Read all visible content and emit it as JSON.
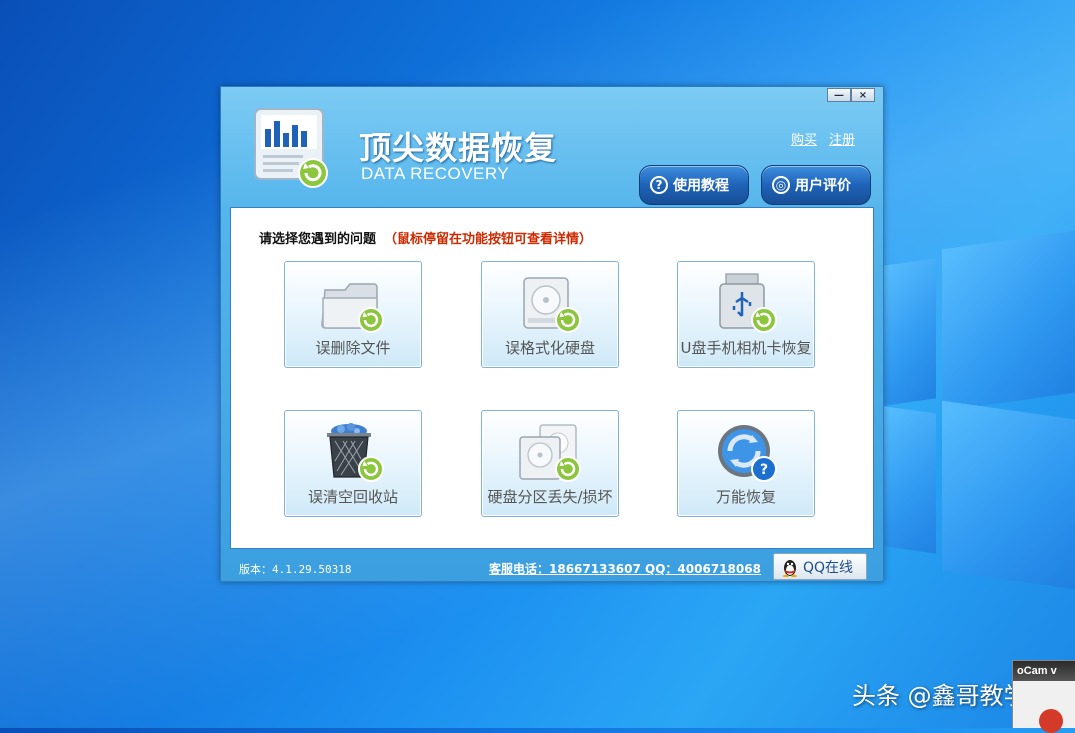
{
  "desktop": {
    "watermark": "头条 @鑫哥教学",
    "ocam_title": "oCam v"
  },
  "app": {
    "title": "顶尖数据恢复",
    "subtitle": "DATA RECOVERY",
    "window_buttons": {
      "minimize": "—",
      "close": "×"
    },
    "top_links": {
      "buy": "购买",
      "register": "注册"
    },
    "header_buttons": {
      "tutorial": "使用教程",
      "review": "用户评价"
    },
    "prompt": "请选择您遇到的问题",
    "hint": "（鼠标停留在功能按钮可查看详情）",
    "tiles": [
      {
        "label": "误删除文件",
        "icon": "folder-recover-icon"
      },
      {
        "label": "误格式化硬盘",
        "icon": "harddisk-recover-icon"
      },
      {
        "label": "U盘手机相机卡恢复",
        "icon": "usb-drive-recover-icon"
      },
      {
        "label": "误清空回收站",
        "icon": "recycle-bin-recover-icon"
      },
      {
        "label": "硬盘分区丢失/损坏",
        "icon": "partition-recover-icon"
      },
      {
        "label": "万能恢复",
        "icon": "universal-recover-icon"
      }
    ],
    "footer": {
      "version": "版本：4.1.29.50318",
      "contact": "客服电话：18667133607 QQ：4006718068",
      "qq_online": "QQ在线"
    },
    "colors": {
      "accent": "#3b9fe0",
      "hint_red": "#cc2a00",
      "recover_green": "#8cc63f"
    }
  }
}
